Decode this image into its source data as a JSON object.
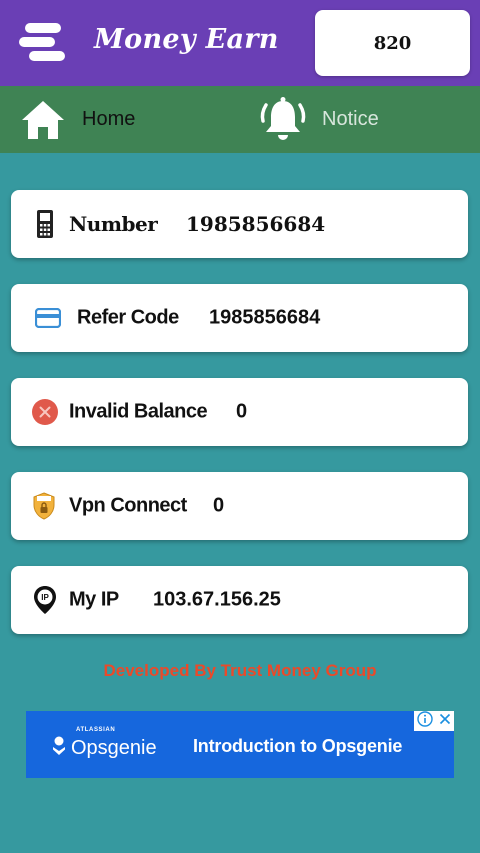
{
  "app": {
    "title": "Money Earn",
    "coin_value": "820"
  },
  "nav": {
    "home_label": "Home",
    "notice_label": "Notice"
  },
  "cards": {
    "number": {
      "label": "Number",
      "value": "1985856684",
      "icon": "phone-icon"
    },
    "refer": {
      "label": "Refer Code",
      "value": "1985856684",
      "icon": "card-icon"
    },
    "invalid": {
      "label": "Invalid Balance",
      "value": "0",
      "icon": "error-circle-icon"
    },
    "vpn": {
      "label": "Vpn Connect",
      "value": "0",
      "icon": "vpn-shield-icon"
    },
    "ip": {
      "label": "My IP",
      "value": "103.67.156.25",
      "icon": "ip-pin-icon"
    }
  },
  "footer": {
    "developed_by": "Developed By Trust Money Group"
  },
  "ad": {
    "brand_small": "ATLASSIAN",
    "brand": "Opsgenie",
    "headline": "Introduction to Opsgenie"
  },
  "colors": {
    "topbar": "#6a3fb5",
    "navbar": "#3f8354",
    "background": "#36999f",
    "footer_text": "#ea4a2a",
    "ad_background": "#1667dd"
  }
}
